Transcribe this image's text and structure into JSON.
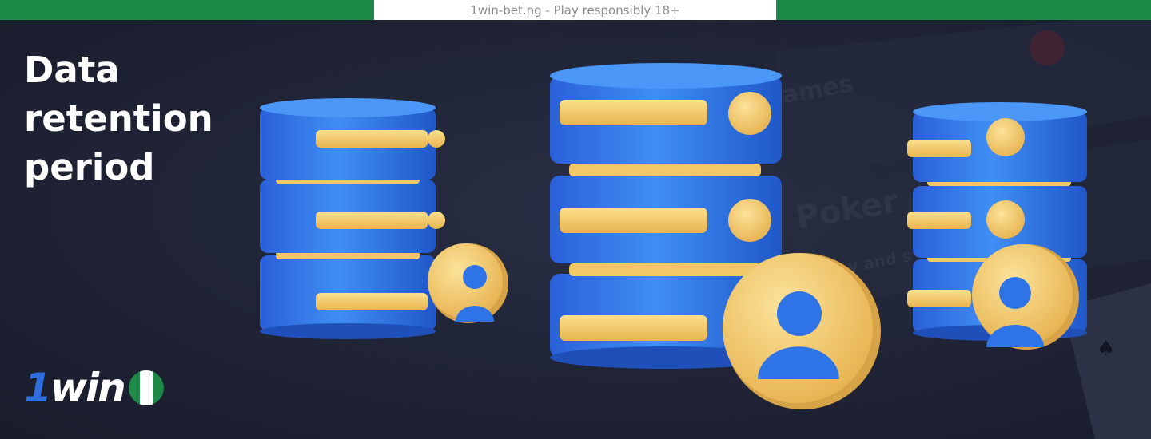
{
  "topbar": {
    "notice": "1win-bet.ng - Play responsibly 18+"
  },
  "headline": {
    "lines": [
      "Data",
      "retention",
      "period"
    ]
  },
  "background": {
    "games_text": "ames",
    "poker_text": "Poker",
    "poker_sub_text": "y and s"
  },
  "logo": {
    "prefix": "1",
    "suffix": "win",
    "flag": "nigeria-flag-icon"
  },
  "icons": {
    "servers": [
      "database-server-icon",
      "database-server-icon",
      "database-server-icon"
    ],
    "user": "user-icon"
  },
  "colors": {
    "topbar_green": "#1e8a4a",
    "background": "#1e2233",
    "server_blue": "#2f74e6",
    "accent_yellow": "#f3c863",
    "logo_blue": "#2f6de1"
  }
}
